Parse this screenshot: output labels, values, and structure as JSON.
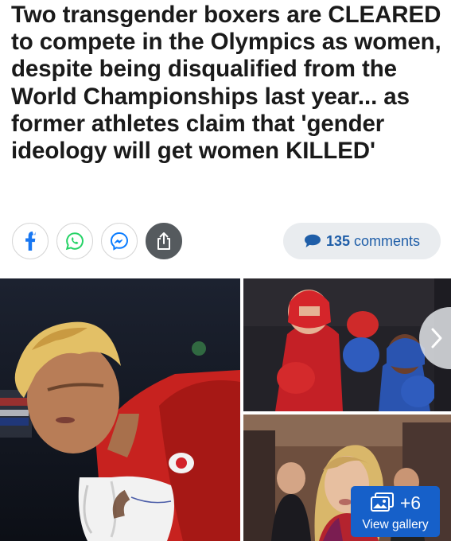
{
  "article": {
    "headline": "Two transgender boxers are CLEARED to compete in the Olympics as women, despite being disqualified from the World Championships last year... as former athletes claim that 'gender ideology will get women KILLED'"
  },
  "share": {
    "icons": [
      "facebook-icon",
      "whatsapp-icon",
      "messenger-icon",
      "share-icon"
    ],
    "comments_count": "135",
    "comments_label": "comments"
  },
  "gallery": {
    "extra_count": "+6",
    "view_label": "View gallery"
  },
  "colors": {
    "link_blue": "#1f5ea8",
    "gallery_button": "#1660c9",
    "facebook": "#1877f2",
    "whatsapp": "#25d366",
    "messenger": "#0a7cff",
    "share_bg": "#555a5e"
  }
}
